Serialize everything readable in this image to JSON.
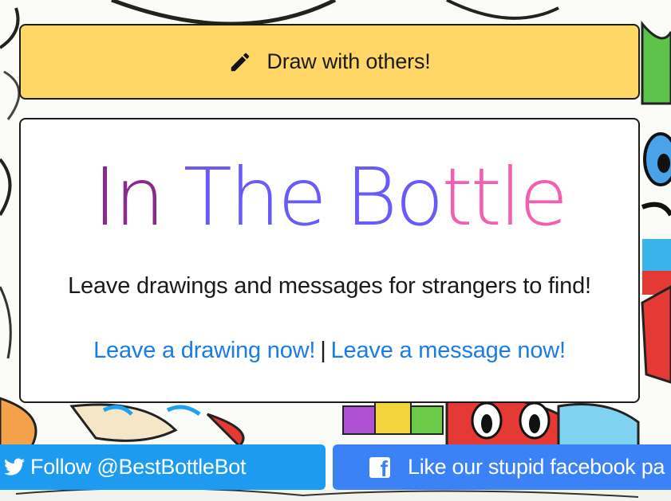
{
  "header_button": {
    "label": "Draw with others!",
    "icon": "pencil-icon"
  },
  "brand": {
    "logo_words": [
      "In",
      "The",
      "Bo",
      "ttle"
    ],
    "colors": {
      "in": "#8a2a8a",
      "the": "#6a5af9",
      "bottle_start": "#6a5af9",
      "bottle_end": "#f25eb0"
    }
  },
  "hero": {
    "tagline": "Leave drawings and messages for strangers to find!",
    "link_drawing": "Leave a drawing now!",
    "separator": "|",
    "link_message": "Leave a message now!"
  },
  "social": {
    "twitter_label": "Follow @BestBottleBot",
    "twitter_icon": "twitter-bird-icon",
    "facebook_label": "Like our stupid facebook pa",
    "facebook_icon": "facebook-icon"
  },
  "colors": {
    "header_button_bg": "#ffd766",
    "link": "#1a7ce6",
    "twitter": "#1d9bf0",
    "facebook": "#3b82f6"
  }
}
